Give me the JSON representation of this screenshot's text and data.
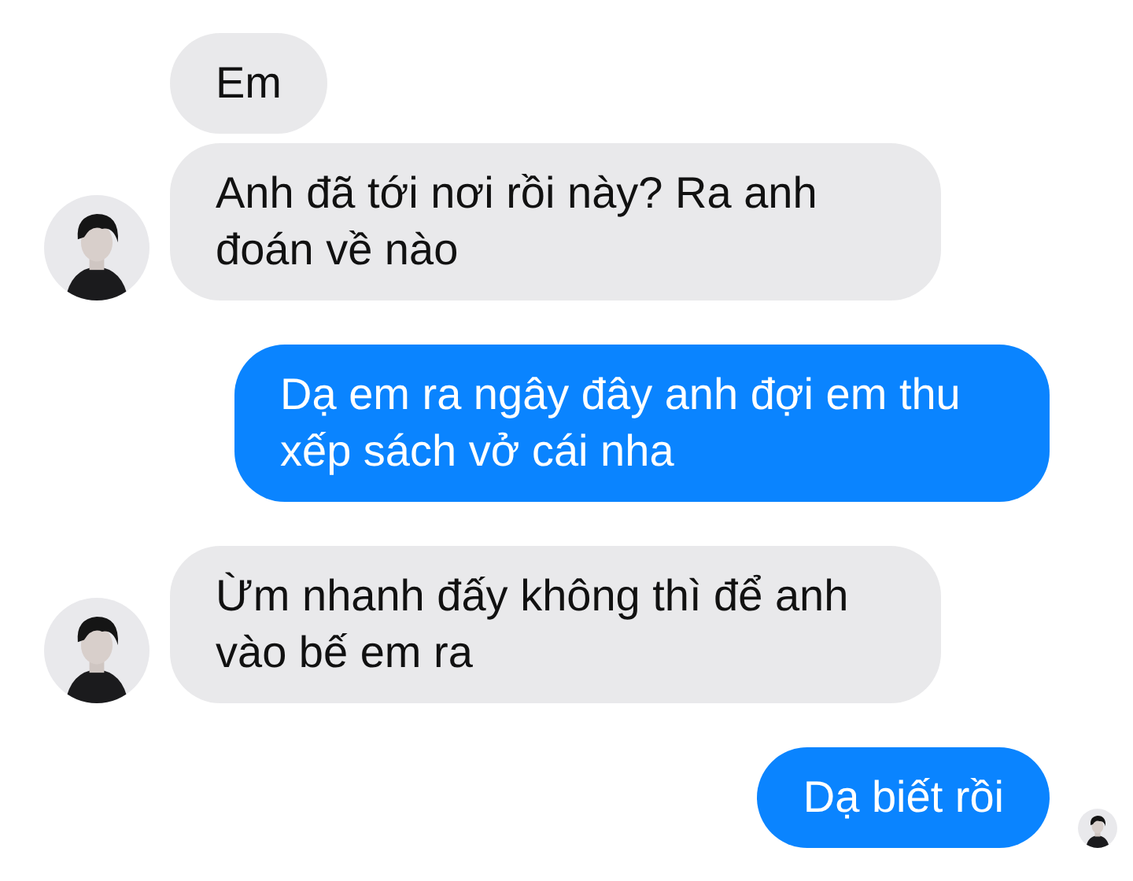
{
  "messages": [
    {
      "kind": "incoming",
      "text": "Em",
      "avatar": false
    },
    {
      "kind": "incoming",
      "text": "Anh đã tới nơi rồi này? Ra anh đoán về nào",
      "avatar": true
    },
    {
      "kind": "outgoing",
      "text": "Dạ em ra ngây đây anh đợi em thu xếp sách vở cái nha",
      "seen": false
    },
    {
      "kind": "incoming",
      "text": "Ừm nhanh đấy không thì để anh vào bế em ra",
      "avatar": true
    },
    {
      "kind": "outgoing",
      "text": "Dạ biết rồi",
      "seen": true
    }
  ]
}
